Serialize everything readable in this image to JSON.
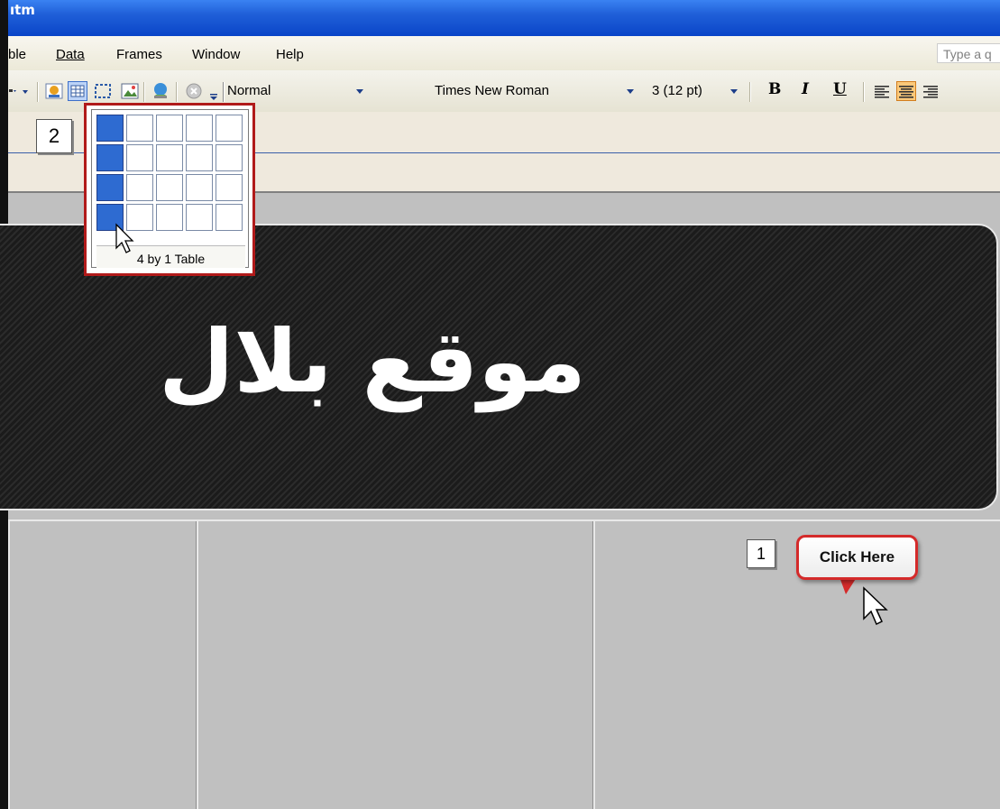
{
  "title_bar": {
    "title": "ıtm"
  },
  "menu": {
    "items": [
      "ble",
      "Data",
      "Frames",
      "Window",
      "Help"
    ],
    "help_search_placeholder": "Type a q"
  },
  "toolbar": {
    "style_value": "Normal",
    "font_value": "Times New Roman",
    "size_value": "3 (12 pt)",
    "bold_label": "B",
    "italic_label": "I",
    "underline_label": "U"
  },
  "steps": {
    "step1": "1",
    "step2": "2"
  },
  "table_picker": {
    "rows": 4,
    "cols": 5,
    "selected_rows": 4,
    "selected_cols": 1,
    "label": "4 by 1 Table"
  },
  "banner": {
    "text": "موقع بلال"
  },
  "callout": {
    "text": "Click Here",
    "border_color": "#d42a2a"
  },
  "colors": {
    "selection": "#2e6bd1",
    "titlebar": "#1f5fd8"
  }
}
